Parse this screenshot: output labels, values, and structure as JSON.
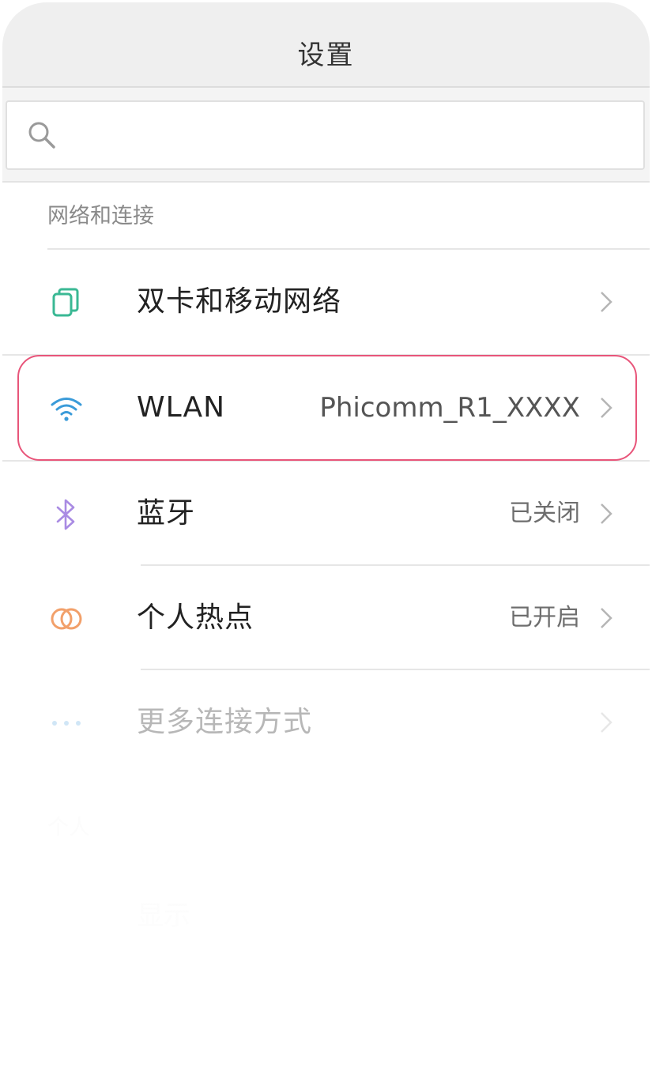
{
  "header": {
    "title": "设置"
  },
  "search": {
    "placeholder": "",
    "value": ""
  },
  "sections": [
    {
      "title": "网络和连接",
      "items": [
        {
          "label": "双卡和移动网络",
          "value": "",
          "icon": "dual-sim-icon",
          "icon_color": "#3ab894"
        },
        {
          "label": "WLAN",
          "value": "Phicomm_R1_XXXX",
          "icon": "wifi-icon",
          "icon_color": "#3a9bd9",
          "highlighted": true
        },
        {
          "label": "蓝牙",
          "value": "已关闭",
          "icon": "bluetooth-icon",
          "icon_color": "#a98be3"
        },
        {
          "label": "个人热点",
          "value": "已开启",
          "icon": "hotspot-icon",
          "icon_color": "#f2a06a"
        },
        {
          "label": "更多连接方式",
          "value": "",
          "icon": "more-dots-icon",
          "icon_color": "#6fb2e6"
        }
      ]
    },
    {
      "title": "个人",
      "items": [
        {
          "label": "显示",
          "value": ""
        }
      ]
    }
  ],
  "colors": {
    "highlight_border": "#e8557a",
    "title_bar_bg": "#efefef"
  }
}
